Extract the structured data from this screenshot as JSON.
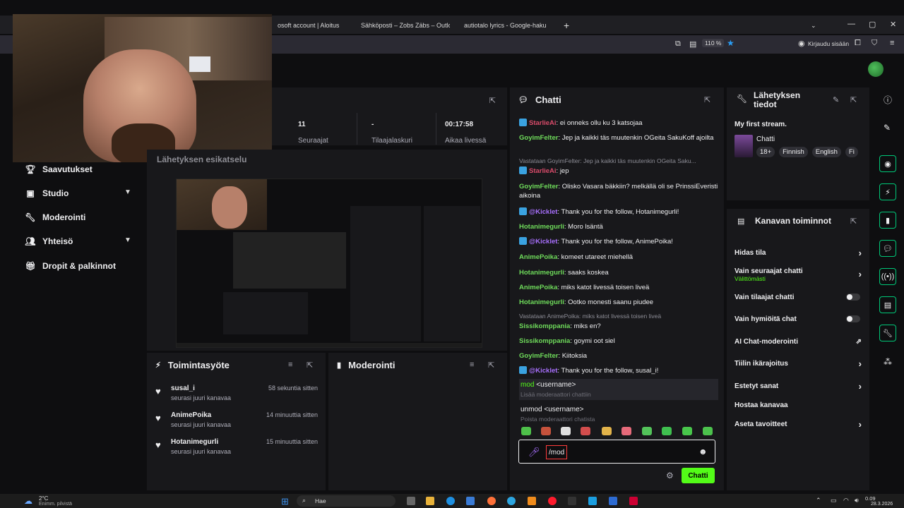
{
  "browser": {
    "tabs": [
      {
        "label": "osoft account | Aloitus",
        "color": "#1f1f23"
      },
      {
        "label": "Sähköposti – Zobs Zäbs – Outlo",
        "color": "#0a64d6"
      },
      {
        "label": "autiotalo lyrics - Google-haku",
        "color": "#ea4335"
      }
    ],
    "zoom": "110 %",
    "signin_label": "Kirjaudu sisään"
  },
  "nav": {
    "items": [
      {
        "label": "Saavutukset",
        "icon": "trophy-icon"
      },
      {
        "label": "Studio",
        "icon": "film-icon"
      },
      {
        "label": "Moderointi",
        "icon": "wrench-icon"
      },
      {
        "label": "Yhteisö",
        "icon": "people-icon"
      },
      {
        "label": "Dropit & palkinnot",
        "icon": "gift-icon"
      }
    ]
  },
  "stats": {
    "section_title": "Lähetyksen esikatselu",
    "values": [
      {
        "value": "11",
        "label": "Seuraajat"
      },
      {
        "value": "-",
        "label": "Tilaajalaskuri"
      },
      {
        "value": "00:17:58",
        "label": "Aikaa livessä"
      }
    ]
  },
  "activity": {
    "title": "Toimintasyöte",
    "items": [
      {
        "name": "susal_i",
        "sub": "seurasi juuri kanavaa",
        "time": "58 sekuntia sitten"
      },
      {
        "name": "AnimePoika",
        "sub": "seurasi juuri kanavaa",
        "time": "14 minuuttia sitten"
      },
      {
        "name": "Hotanimegurli",
        "sub": "seurasi juuri kanavaa",
        "time": "15 minuuttia sitten"
      }
    ]
  },
  "moderation": {
    "title": "Moderointi"
  },
  "chat": {
    "title": "Chatti",
    "lines": [
      {
        "user": "StarlieAi",
        "text": ": ei onneks ollu ku 3 katsojaa",
        "color": "#d94b6a"
      },
      {
        "user": "GoyimFelter",
        "text": ": Jep ja kaikki täs muutenkin OGeita SakuKoff ajoilta",
        "color": "#6fdc5b"
      },
      {
        "reply": "Vastataan GoyimFelter: Jep ja kaikki täs muutenkin OGeita Saku..."
      },
      {
        "user": "StarlieAi",
        "text": ": jep",
        "color": "#d94b6a"
      },
      {
        "user": "GoyimFelter",
        "text": ": Olisko Vasara bäkkiin? melkällä oli se PrinssiEveristi aikoina",
        "color": "#6fdc5b"
      },
      {
        "user": "@Kicklet",
        "text": ": Thank you for the follow, Hotanimegurli!",
        "color": "#a970ff"
      },
      {
        "user": "Hotanimegurli",
        "text": ": Moro lsäntä",
        "color": "#6fdc5b"
      },
      {
        "user": "@Kicklet",
        "text": ": Thank you for the follow, AnimePoika!",
        "color": "#a970ff"
      },
      {
        "user": "AnimePoika",
        "text": ": komeet utareet miehellä",
        "color": "#6fdc5b"
      },
      {
        "user": "Hotanimegurli",
        "text": ": saaks koskea",
        "color": "#6fdc5b"
      },
      {
        "user": "AnimePoika",
        "text": ": miks katot livessä toisen liveä",
        "color": "#6fdc5b"
      },
      {
        "user": "Hotanimegurli",
        "text": ": Ootko monesti saanu piudee",
        "color": "#6fdc5b"
      },
      {
        "reply": "Vastataan AnimePoika: miks katot livessä toisen liveä"
      },
      {
        "user": "Sissikomppania",
        "text": ": miks en?",
        "color": "#6fdc5b"
      },
      {
        "user": "Sissikomppania",
        "text": ": goymi oot siel",
        "color": "#6fdc5b"
      },
      {
        "user": "GoyimFelter",
        "text": ": Kiitoksia",
        "color": "#6fdc5b"
      },
      {
        "user": "@Kicklet",
        "text": ": Thank you for the follow, susal_i!",
        "color": "#a970ff"
      }
    ],
    "suggestions": [
      {
        "cmd_hi": "mod",
        "cmd_rest": " <username>",
        "desc": "Lisää moderaattori chattiin"
      },
      {
        "cmd_hi": "un",
        "cmd_rest": "mod <username>",
        "desc": "Poista moderaattori chatista"
      }
    ],
    "input_value": "/mod",
    "send_label": "Chatti"
  },
  "stream_info": {
    "title_line1": "Lähetyksen",
    "title_line2": "tiedot",
    "stream_title": "My first stream.",
    "category": "Chatti",
    "tags": [
      "18+",
      "Finnish",
      "English",
      "Fi"
    ]
  },
  "channel_actions": {
    "title": "Kanavan toiminnot",
    "items": [
      {
        "label": "Hidas tila",
        "control": "chevron"
      },
      {
        "label": "Vain seuraajat chatti",
        "sub": "Välittömästi",
        "control": "chevron"
      },
      {
        "label": "Vain tilaajat chatti",
        "control": "toggle"
      },
      {
        "label": "Vain hymiöitä chat",
        "control": "toggle"
      },
      {
        "label": "AI Chat-moderointi",
        "control": "external"
      },
      {
        "label": "Tiilin ikärajoitus",
        "control": "chevron"
      },
      {
        "label": "Estetyt sanat",
        "control": "chevron"
      },
      {
        "label": "Hostaa kanavaa",
        "control": "none"
      },
      {
        "label": "Aseta tavoitteet",
        "control": "chevron"
      }
    ]
  },
  "taskbar": {
    "weather_temp": "2°C",
    "weather_desc": "Enimm. pilvistä",
    "search": "Hae",
    "time": "0.09",
    "date": "28.3.2026"
  },
  "colors": {
    "accent": "#53fc18",
    "bg": "#0e0e10",
    "panel": "#18181b"
  }
}
